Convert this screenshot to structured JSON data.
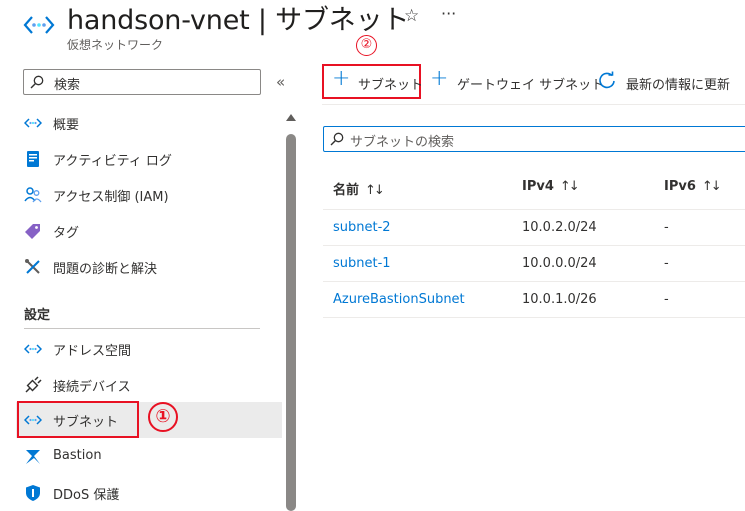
{
  "header": {
    "title": "handson-vnet | サブネット",
    "subtitle": "仮想ネットワーク",
    "star_icon": "☆",
    "more_icon": "···"
  },
  "sidebar": {
    "search_placeholder": "検索",
    "collapse_icon": "«",
    "items_top": [
      {
        "label": "概要",
        "icon": "vnet-icon"
      },
      {
        "label": "アクティビティ ログ",
        "icon": "activity-log-icon"
      },
      {
        "label": "アクセス制御 (IAM)",
        "icon": "iam-icon"
      },
      {
        "label": "タグ",
        "icon": "tag-icon"
      },
      {
        "label": "問題の診断と解決",
        "icon": "tools-icon"
      }
    ],
    "section_title": "設定",
    "items_settings": [
      {
        "label": "アドレス空間",
        "icon": "vnet-icon"
      },
      {
        "label": "接続デバイス",
        "icon": "plug-icon"
      },
      {
        "label": "サブネット",
        "icon": "vnet-icon",
        "selected": true
      },
      {
        "label": "Bastion",
        "icon": "bastion-icon"
      },
      {
        "label": "DDoS 保護",
        "icon": "shield-icon"
      }
    ],
    "annotation_1": "①"
  },
  "toolbar": {
    "annotation_2": "②",
    "plus": "+",
    "add_subnet": "サブネット",
    "gateway_subnet": "ゲートウェイ サブネット",
    "refresh": "最新の情報に更新"
  },
  "content": {
    "search_placeholder": "サブネットの検索",
    "columns": [
      "名前",
      "IPv4",
      "IPv6"
    ],
    "sort_icon": "↑↓",
    "rows": [
      {
        "name": "subnet-2",
        "ipv4": "10.0.2.0/24",
        "ipv6": "-"
      },
      {
        "name": "subnet-1",
        "ipv4": "10.0.0.0/24",
        "ipv6": "-"
      },
      {
        "name": "AzureBastionSubnet",
        "ipv4": "10.0.1.0/26",
        "ipv6": "-"
      }
    ]
  },
  "colors": {
    "accent": "#0078d4",
    "annotation": "#e81123",
    "selected_bg": "#ebebeb"
  }
}
